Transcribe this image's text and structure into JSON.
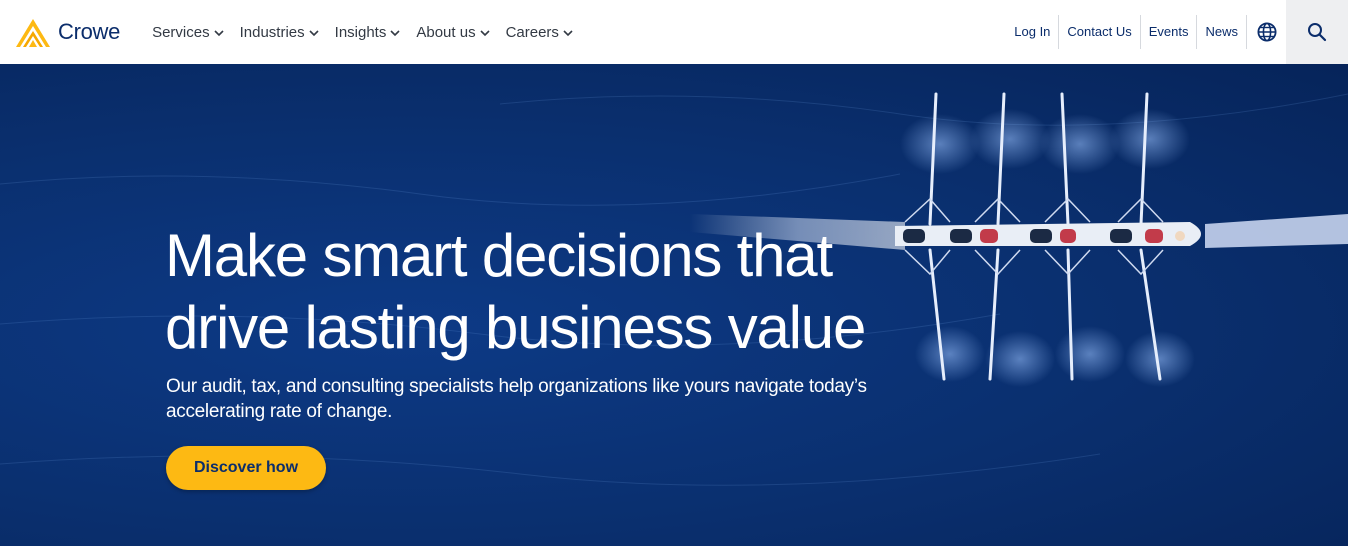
{
  "brand": {
    "name": "Crowe",
    "logo_icon": "crowe-chevron-logo",
    "primary_color": "#0b2d6b",
    "accent_color": "#fdb913"
  },
  "main_nav": {
    "items": [
      {
        "label": "Services",
        "icon": "chevron-down-icon"
      },
      {
        "label": "Industries",
        "icon": "chevron-down-icon"
      },
      {
        "label": "Insights",
        "icon": "chevron-down-icon"
      },
      {
        "label": "About us",
        "icon": "chevron-down-icon"
      },
      {
        "label": "Careers",
        "icon": "chevron-down-icon"
      }
    ]
  },
  "utility_nav": {
    "links": [
      "Log In",
      "Contact Us",
      "Events",
      "News"
    ],
    "globe_icon": "globe-icon",
    "search_icon": "search-icon"
  },
  "hero": {
    "headline_line1": "Make smart decisions that",
    "headline_line2": "drive lasting business value",
    "subtext_line1": "Our audit, tax, and consulting specialists help organizations like yours navigate today’s",
    "subtext_line2": "accelerating rate of change.",
    "cta_label": "Discover how",
    "background_image": "aerial view of rowing boat on deep blue water"
  }
}
